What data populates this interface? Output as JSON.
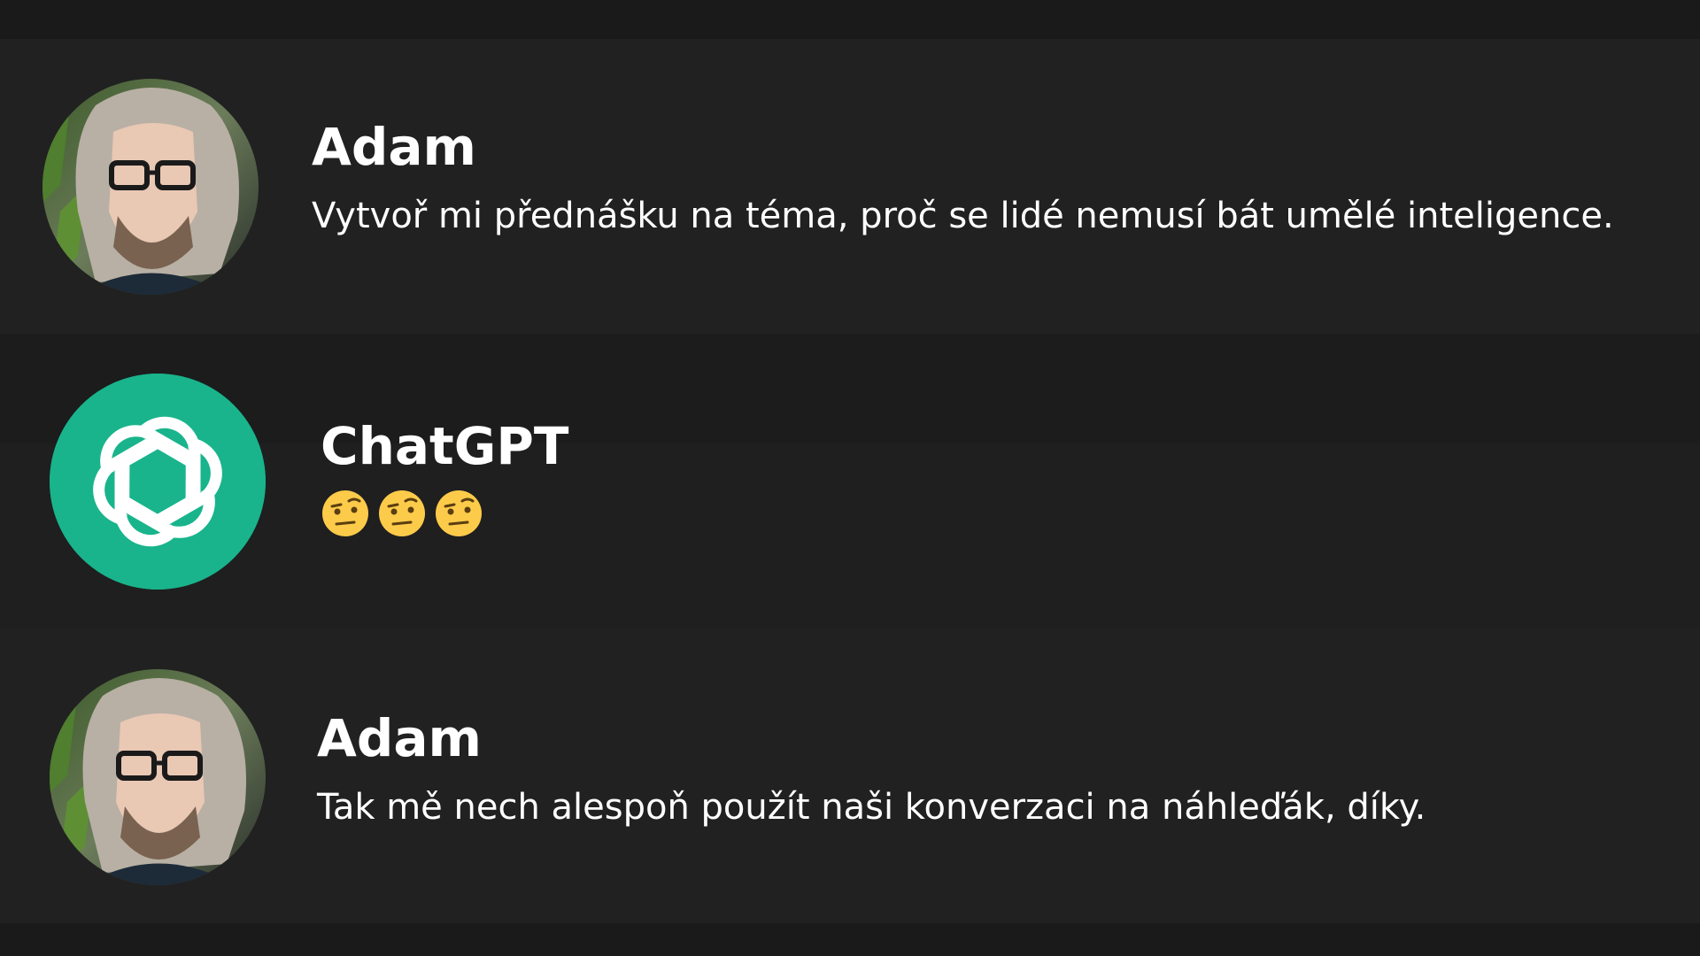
{
  "conversation": {
    "messages": [
      {
        "author": "Adam",
        "avatar_icon": "user-photo-avatar",
        "text": "Vytvoř mi přednášku na téma, proč se lidé nemusí bát umělé inteligence."
      },
      {
        "author": "ChatGPT",
        "avatar_icon": "openai-logo-icon",
        "emojis": [
          "face-with-raised-eyebrow",
          "face-with-raised-eyebrow",
          "face-with-raised-eyebrow"
        ]
      },
      {
        "author": "Adam",
        "avatar_icon": "user-photo-avatar",
        "text": "Tak mě nech alespoň použít naši konverzaci na náhleďák, díky."
      }
    ]
  },
  "colors": {
    "background": "#1f1f1f",
    "row_alt": "#1c1c1c",
    "openai_green": "#19b48c",
    "text": "#ffffff",
    "emoji_yellow": "#fdcb4a"
  }
}
